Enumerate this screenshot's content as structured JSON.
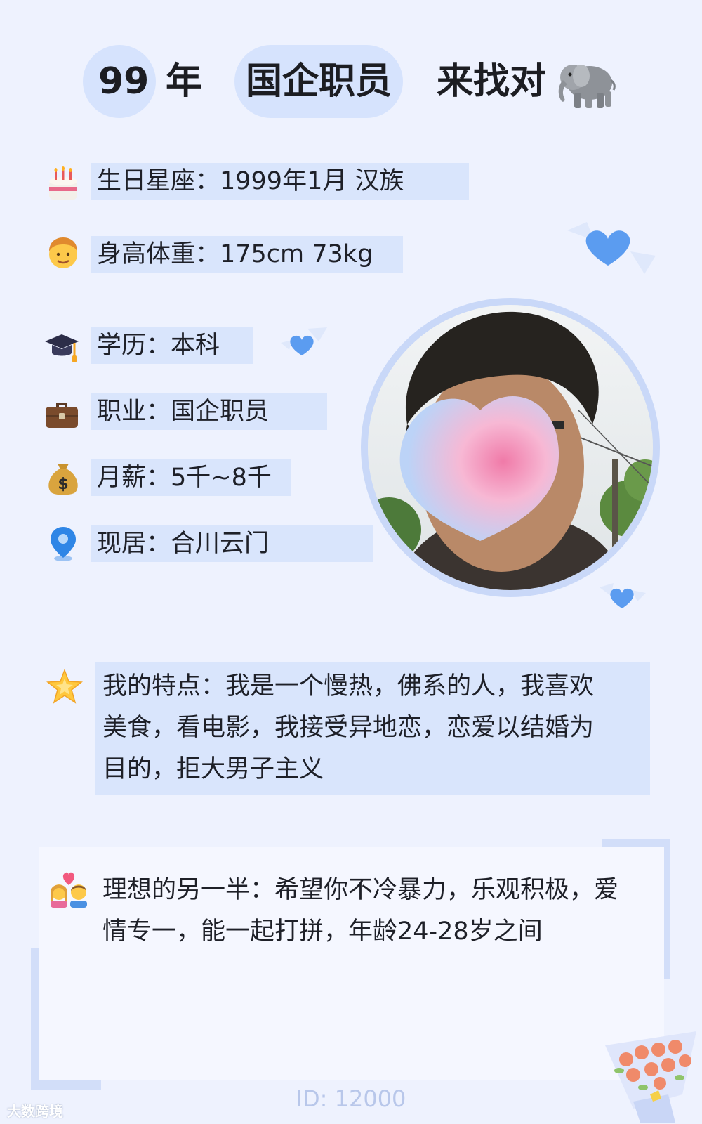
{
  "header": {
    "year": "99",
    "year_suffix": "年",
    "job": "国企职员",
    "tagline": "来找对"
  },
  "info": {
    "birthday": "生日星座：1999年1月 汉族",
    "height_weight": "身高体重：175cm 73kg",
    "education": "学历：本科",
    "job": "职业：国企职员",
    "salary": "月薪：5千~8千",
    "location": "现居：合川云门"
  },
  "features": {
    "line1": "我的特点：我是一个慢热，佛系的人，我喜欢",
    "line2": "美食，看电影，我接受异地恋，恋爱以结婚为",
    "line3": "目的，拒大男子主义"
  },
  "ideal": {
    "line1": "理想的另一半：希望你不冷暴力，乐观积极，爱",
    "line2": "情专一，能一起打拼，年龄24-28岁之间"
  },
  "footer": {
    "id": "ID: 12000",
    "watermark": "大数跨境"
  },
  "icons": [
    "elephant-icon",
    "birthday-cake-icon",
    "man-face-icon",
    "graduation-cap-icon",
    "briefcase-icon",
    "money-bag-icon",
    "location-pin-icon",
    "star-icon",
    "couple-with-heart-icon",
    "blue-heart-icon",
    "flower-bouquet-icon"
  ],
  "colors": {
    "background": "#eef2fe",
    "highlight": "#d9e5fc",
    "accent_blue": "#5b9cf0"
  }
}
